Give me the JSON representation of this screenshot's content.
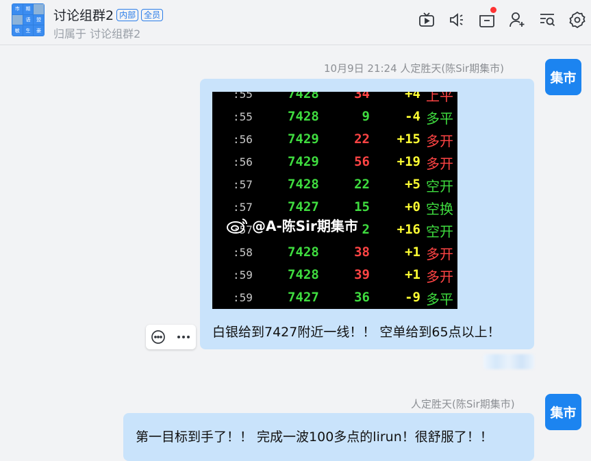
{
  "header": {
    "group_name": "讨论组群2",
    "tag_internal": "内部",
    "tag_all": "全员",
    "subtitle": "归属于 讨论组群2",
    "avatar_cells": [
      "市",
      "期",
      "",
      "",
      "语",
      "盟",
      "敏",
      "生",
      "豪"
    ],
    "toolbar_icons": [
      "tv-icon",
      "voice-icon",
      "folder-icon",
      "add-member-icon",
      "search-history-icon",
      "settings-icon"
    ]
  },
  "messages": [
    {
      "meta": "10月9日 21:24  人定胜天(陈Sir期集市)",
      "avatar_label": "集市",
      "text": "白银给到7427附近一线！！ 空单给到65点以上！",
      "image": {
        "rows": [
          {
            "time": ":55",
            "price": "7428",
            "volume": "9",
            "volume_color": "green",
            "oi": "-4",
            "type": "多平",
            "type_color": "green"
          },
          {
            "time": ":56",
            "price": "7429",
            "volume": "22",
            "volume_color": "red",
            "oi": "+15",
            "type": "多开",
            "type_color": "red"
          },
          {
            "time": ":56",
            "price": "7429",
            "volume": "56",
            "volume_color": "red",
            "oi": "+19",
            "type": "多开",
            "type_color": "red"
          },
          {
            "time": ":57",
            "price": "7428",
            "volume": "22",
            "volume_color": "green",
            "oi": "+5",
            "type": "空开",
            "type_color": "green"
          },
          {
            "time": ":57",
            "price": "7427",
            "volume": "15",
            "volume_color": "green",
            "oi": "+0",
            "type": "空换",
            "type_color": "green"
          },
          {
            "time": ":57",
            "price": "",
            "volume": "2",
            "volume_color": "green",
            "oi": "+16",
            "type": "空开",
            "type_color": "green"
          },
          {
            "time": ":58",
            "price": "7428",
            "volume": "38",
            "volume_color": "red",
            "oi": "+1",
            "type": "多开",
            "type_color": "red"
          },
          {
            "time": ":59",
            "price": "7428",
            "volume": "39",
            "volume_color": "red",
            "oi": "+1",
            "type": "多开",
            "type_color": "red"
          },
          {
            "time": ":59",
            "price": "7427",
            "volume": "36",
            "volume_color": "green",
            "oi": "-9",
            "type": "多平",
            "type_color": "green"
          }
        ],
        "watermark": "@A-陈Sir期集市"
      }
    },
    {
      "meta": "人定胜天(陈Sir期集市)",
      "avatar_label": "集市",
      "text": "第一目标到手了！！ 完成一波100多点的lirun！很舒服了！！"
    }
  ]
}
